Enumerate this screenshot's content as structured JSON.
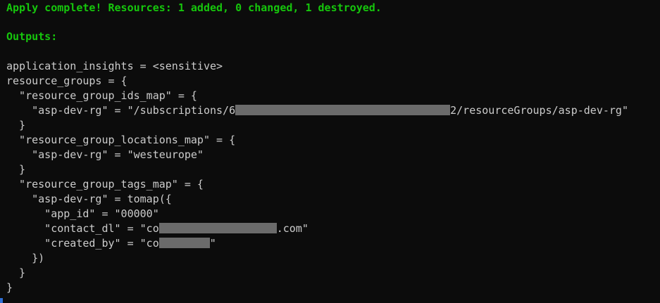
{
  "terminal": {
    "apply_status": "Apply complete! Resources: 1 added, 0 changed, 1 destroyed.",
    "outputs_header": "Outputs:",
    "lines": {
      "application_insights": "application_insights = <sensitive>",
      "resource_groups_open": "resource_groups = {",
      "ids_map_open": "  \"resource_group_ids_map\" = {",
      "ids_map_value_prefix": "    \"asp-dev-rg\" = \"/subscriptions/6",
      "ids_map_value_suffix": "2/resourceGroups/asp-dev-rg\"",
      "ids_map_close": "  }",
      "locations_map_open": "  \"resource_group_locations_map\" = {",
      "locations_map_value": "    \"asp-dev-rg\" = \"westeurope\"",
      "locations_map_close": "  }",
      "tags_map_open": "  \"resource_group_tags_map\" = {",
      "tomap_open": "    \"asp-dev-rg\" = tomap({",
      "app_id": "      \"app_id\" = \"00000\"",
      "contact_dl_prefix": "      \"contact_dl\" = \"co",
      "contact_dl_suffix": ".com\"",
      "created_by_prefix": "      \"created_by\" = \"co",
      "created_by_suffix": "\"",
      "tomap_close": "    })",
      "tags_map_close": "  }",
      "resource_groups_close": "}"
    }
  },
  "colors": {
    "background": "#0c0c0c",
    "text": "#cccccc",
    "status_green": "#16c60c",
    "redaction": "#6b6b6b"
  }
}
